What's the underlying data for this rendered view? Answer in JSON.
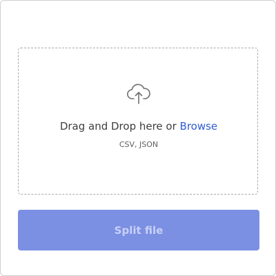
{
  "dropzone": {
    "prefix_text": "Drag and Drop here or ",
    "browse_label": "Browse",
    "formats_text": "CSV, JSON",
    "icon": "cloud-upload-icon"
  },
  "action": {
    "split_label": "Split file",
    "state": "disabled"
  },
  "colors": {
    "link": "#2f5bd3",
    "button_bg": "#7b8fe3",
    "button_text": "#c7d1f7",
    "border": "#a9a9a9"
  }
}
